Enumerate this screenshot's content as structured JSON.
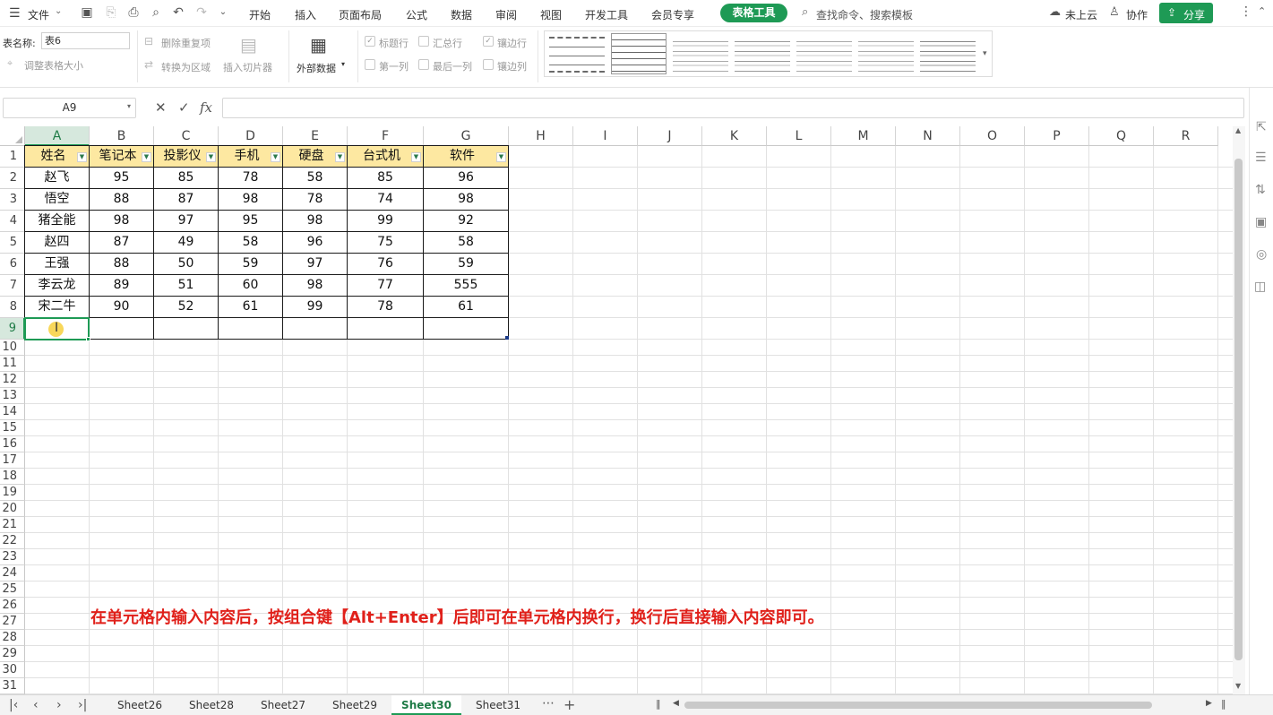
{
  "menu": {
    "file": "文件",
    "tabs": [
      "开始",
      "插入",
      "页面布局",
      "公式",
      "数据",
      "审阅",
      "视图",
      "开发工具",
      "会员专享"
    ],
    "active_tool": "表格工具",
    "search_placeholder": "查找命令、搜索模板",
    "cloud": "未上云",
    "collab": "协作",
    "share": "分享"
  },
  "ribbon": {
    "table_name_label": "表名称:",
    "table_name_value": "表6",
    "resize_table": "调整表格大小",
    "remove_duplicates": "删除重复项",
    "convert_to_range": "转换为区域",
    "insert_slicer": "插入切片器",
    "external_data": "外部数据",
    "options": {
      "header_row": "标题行",
      "total_row": "汇总行",
      "banded_rows": "镶边行",
      "first_column": "第一列",
      "last_column": "最后一列",
      "banded_columns": "镶边列"
    }
  },
  "formula_bar": {
    "name_box": "A9",
    "fx": "fx",
    "formula": ""
  },
  "columns": [
    "A",
    "B",
    "C",
    "D",
    "E",
    "F",
    "G",
    "H",
    "I",
    "J",
    "K",
    "L",
    "M",
    "N",
    "O",
    "P",
    "Q",
    "R"
  ],
  "table": {
    "headers": [
      "姓名",
      "笔记本",
      "投影仪",
      "手机",
      "硬盘",
      "台式机",
      "软件"
    ],
    "rows": [
      [
        "赵飞",
        "95",
        "85",
        "78",
        "58",
        "85",
        "96"
      ],
      [
        "悟空",
        "88",
        "87",
        "98",
        "78",
        "74",
        "98"
      ],
      [
        "猪全能",
        "98",
        "97",
        "95",
        "98",
        "99",
        "92"
      ],
      [
        "赵四",
        "87",
        "49",
        "58",
        "96",
        "75",
        "58"
      ],
      [
        "王强",
        "88",
        "50",
        "59",
        "97",
        "76",
        "59"
      ],
      [
        "李云龙",
        "89",
        "51",
        "60",
        "98",
        "77",
        "555"
      ],
      [
        "宋二牛",
        "90",
        "52",
        "61",
        "99",
        "78",
        "61"
      ]
    ]
  },
  "annotation": "在单元格内输入内容后，按组合键【Alt+Enter】后即可在单元格内换行，换行后直接输入内容即可。",
  "sheets": [
    "Sheet26",
    "Sheet28",
    "Sheet27",
    "Sheet29",
    "Sheet30",
    "Sheet31"
  ],
  "active_sheet": "Sheet30",
  "colors": {
    "accent": "#1e9a55",
    "table_header": "#fde8a1",
    "annotation": "#e0201a"
  }
}
